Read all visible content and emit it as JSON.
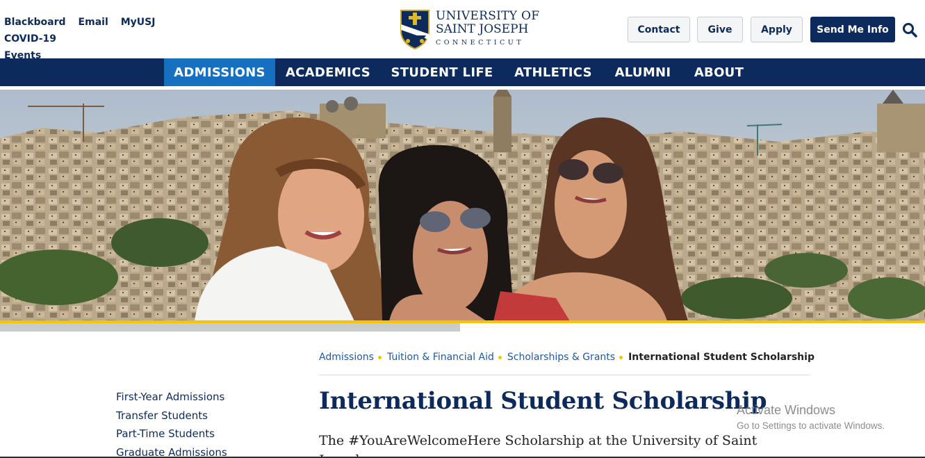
{
  "utility_links": [
    "Blackboard",
    "Email",
    "MyUSJ",
    "COVID-19",
    "Events"
  ],
  "logo": {
    "line1": "UNIVERSITY OF",
    "line2": "SAINT JOSEPH",
    "line3": "CONNECTICUT"
  },
  "header_buttons": {
    "contact": "Contact",
    "give": "Give",
    "apply": "Apply",
    "send_info": "Send Me Info"
  },
  "nav": [
    {
      "label": "ADMISSIONS",
      "active": true
    },
    {
      "label": "ACADEMICS",
      "active": false
    },
    {
      "label": "STUDENT LIFE",
      "active": false
    },
    {
      "label": "ATHLETICS",
      "active": false
    },
    {
      "label": "ALUMNI",
      "active": false
    },
    {
      "label": "ABOUT",
      "active": false
    }
  ],
  "breadcrumb": {
    "items": [
      "Admissions",
      "Tuition & Financial Aid",
      "Scholarships & Grants"
    ],
    "current": "International Student Scholarship"
  },
  "sidebar": {
    "items": [
      "First-Year Admissions",
      "Transfer Students",
      "Part-Time Students",
      "Graduate Admissions"
    ]
  },
  "page": {
    "title": "International Student Scholarship",
    "intro": "The #YouAreWelcomeHere Scholarship at the University of Saint Joseph"
  },
  "watermark": {
    "line1": "Activate Windows",
    "line2": "Go to Settings to activate Windows."
  },
  "colors": {
    "navy": "#0d2a5c",
    "active_nav": "#1670bf",
    "accent_yellow": "#f5c500"
  }
}
